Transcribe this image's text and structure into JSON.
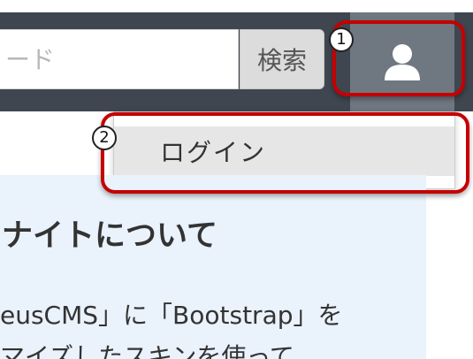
{
  "header": {
    "search": {
      "placeholder": "ード",
      "button_label": "検索"
    },
    "user_menu": {
      "icon": "user-icon",
      "items": [
        {
          "label": "ログイン"
        }
      ]
    }
  },
  "content": {
    "heading": "ナイトについて",
    "lines": [
      "eusCMS」に「Bootstrap」を",
      "マイズしたスキンを使って"
    ]
  },
  "annotations": {
    "markers": [
      "1",
      "2"
    ],
    "color": "#c40000"
  },
  "colors": {
    "navbar": "#3f4650",
    "user_button": "#6f7781",
    "content_background": "#eaf2fc"
  }
}
